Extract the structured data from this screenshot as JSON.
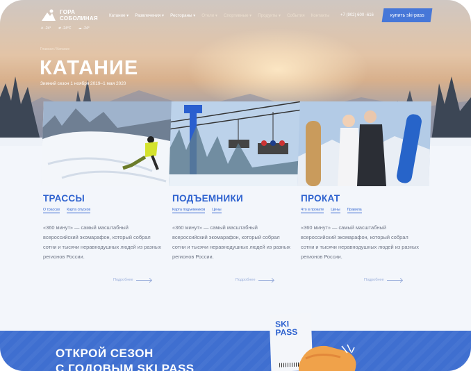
{
  "brand": {
    "logo_text": "ГОРА\nСОБОЛИНАЯ",
    "logo_line1": "ГОРА",
    "logo_line2": "СОБОЛИНАЯ"
  },
  "weather": [
    {
      "icon": "temperature-icon",
      "text": "-24°"
    },
    {
      "icon": "snow-icon",
      "text": "-24°C"
    },
    {
      "icon": "cloud-icon",
      "text": "-24°"
    }
  ],
  "nav": {
    "items": [
      {
        "label": "Катание ▾"
      },
      {
        "label": "Развлечения ▾"
      },
      {
        "label": "Рестораны ▾"
      },
      {
        "label": "Отели ▾"
      },
      {
        "label": "Спортивные ▾"
      },
      {
        "label": "Продукты ▾"
      },
      {
        "label": "События"
      },
      {
        "label": "Контакты"
      }
    ],
    "phone": "+7 (902) 600 -616",
    "buy_button": "купить ski-pass"
  },
  "breadcrumb": "Главная / Катание",
  "page_title": "КАТАНИЕ",
  "season": "Зимний сезон    1 ноября 2019–1 мая 2020",
  "columns": [
    {
      "title": "ТРАССЫ",
      "links": [
        "О трассах",
        "Карта спусков"
      ],
      "desc": "«360 минут» — самый масштабный всероссийский экомарафон, который собрал сотни и тысячи неравнодушных людей из разных регионов России.",
      "more": "Подробнее"
    },
    {
      "title": "ПОДЪЕМНИКИ",
      "links": [
        "Карта подъемников",
        "Цены"
      ],
      "desc": "«360 минут» — самый масштабный всероссийский экомарафон, который собрал сотни и тысячи неравнодушных людей из разных регионов России.",
      "more": "Подробнее"
    },
    {
      "title": "ПРОКАТ",
      "links": [
        "Что в прокате",
        "Цены",
        "Правила"
      ],
      "desc": "«360 минут» — самый масштабный всероссийский экомарафон, который собрал сотни и тысячи неравнодушных людей из разных регионов России.",
      "more": "Подробнее"
    }
  ],
  "promo": {
    "title_line1": "ОТКРОЙ СЕЗОН",
    "title_line2": "С ГОДОВЫМ SKI PASS",
    "card_line1": "SKI",
    "card_line2": "PASS"
  },
  "colors": {
    "accent": "#2e62cf",
    "button": "#4677d8",
    "band": "#3f6fd0",
    "text_muted": "#6e7585"
  }
}
